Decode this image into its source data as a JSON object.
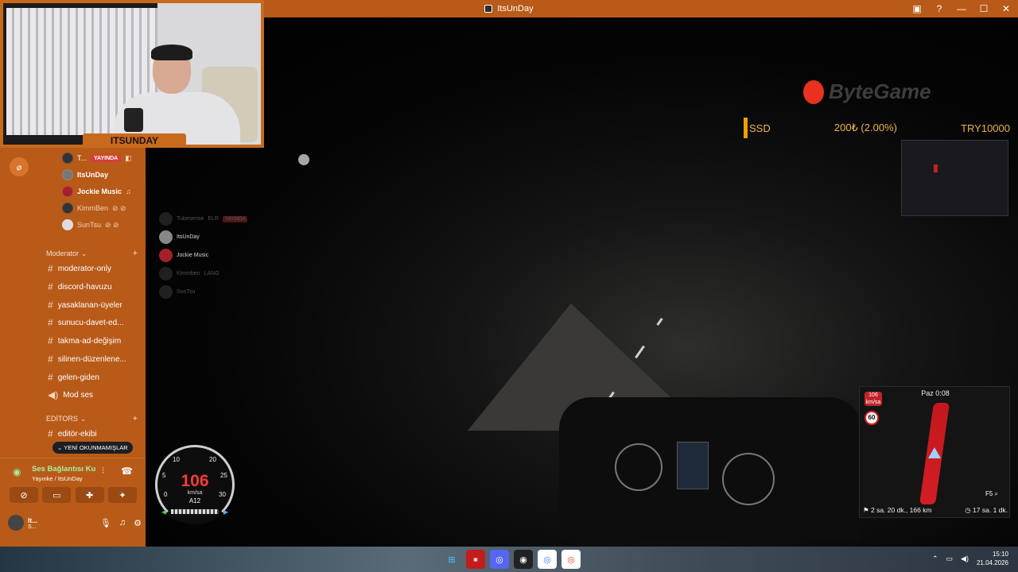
{
  "window": {
    "title": "ItsUnDay",
    "controls": [
      "▣",
      "?",
      "—",
      "☐",
      "✕"
    ]
  },
  "webcam": {
    "name": "ITSUNDAY"
  },
  "overlay": {
    "brand": "ByteGame",
    "ticker": {
      "left": "SSD",
      "mid": "200₺ (2.00%)",
      "right": "TRY10000"
    },
    "voice_rows": [
      {
        "name": "Tubesense",
        "extra": "ELR",
        "badge": "YAYINDA"
      },
      {
        "name": "ItsUnDay",
        "extra": "",
        "badge": ""
      },
      {
        "name": "Jockie Music",
        "extra": "",
        "badge": ""
      },
      {
        "name": "Kimmben",
        "extra": "LANG",
        "badge": ""
      },
      {
        "name": "SunTsu",
        "extra": "",
        "badge": ""
      }
    ]
  },
  "speedometer": {
    "speed": "106",
    "unit": "km/sa",
    "road": "A12",
    "ticks": [
      "10",
      "20",
      "5",
      "25",
      "0",
      "30"
    ],
    "speed_value": 106
  },
  "gps": {
    "time": "Paz 0:08",
    "current_speed": "106",
    "current_unit": "km/sa",
    "speed_limit": "60",
    "trip": "2 sa. 20 dk., 166 km",
    "eta": "17 sa. 1 dk.",
    "hotkey": "F5"
  },
  "discord": {
    "voice_members": [
      {
        "name": "T...",
        "live": "YAYINDA",
        "icon": "camera-icon"
      },
      {
        "name": "ItsUnDay",
        "live": "",
        "icon": ""
      },
      {
        "name": "Jockie Music",
        "live": "",
        "icon": "headphone-icon"
      },
      {
        "name": "KimmBen",
        "live": "",
        "icon": "muted-icon"
      },
      {
        "name": "SunTsu",
        "live": "",
        "icon": "muted-icon"
      }
    ],
    "categories": [
      {
        "name": "Moderator"
      },
      {
        "name": "EDİTORS"
      }
    ],
    "channels": [
      {
        "name": "moderator-only",
        "type": "text"
      },
      {
        "name": "discord-havuzu",
        "type": "text"
      },
      {
        "name": "yasaklanan-üyeler",
        "type": "text"
      },
      {
        "name": "sunucu-davet-ed...",
        "type": "text"
      },
      {
        "name": "takma-ad-değişim",
        "type": "text"
      },
      {
        "name": "silinen-düzenlene...",
        "type": "text"
      },
      {
        "name": "gelen-giden",
        "type": "text"
      },
      {
        "name": "Mod ses",
        "type": "voice"
      },
      {
        "name": "editör-ekibi",
        "type": "text"
      }
    ],
    "unread_label": "YENİ OKUNMAMIŞLAR",
    "voice_panel": {
      "title": "Ses Bağlantısı Ku",
      "subtitle": "Yayınke / ItsUnDay"
    },
    "user": {
      "name": "It...",
      "status": "S..."
    }
  },
  "taskbar": {
    "time": "15:10",
    "date": "21.04.2026"
  },
  "colors": {
    "accent": "#b85a18",
    "live": "#d83c3e",
    "connected": "#a4f2a4"
  }
}
